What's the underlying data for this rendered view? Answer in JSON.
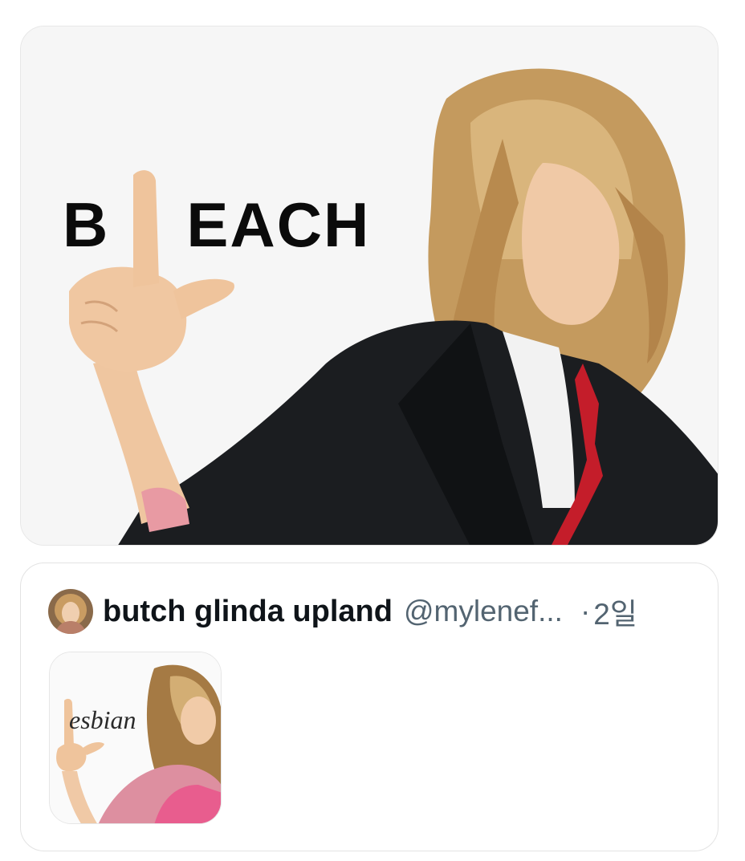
{
  "media": {
    "caption_left": "B",
    "caption_right": "EACH"
  },
  "quote": {
    "display_name": "butch glinda upland",
    "handle": "@mylenef...",
    "separator": "·",
    "time": "2일",
    "thumbnail_caption": "esbian"
  }
}
